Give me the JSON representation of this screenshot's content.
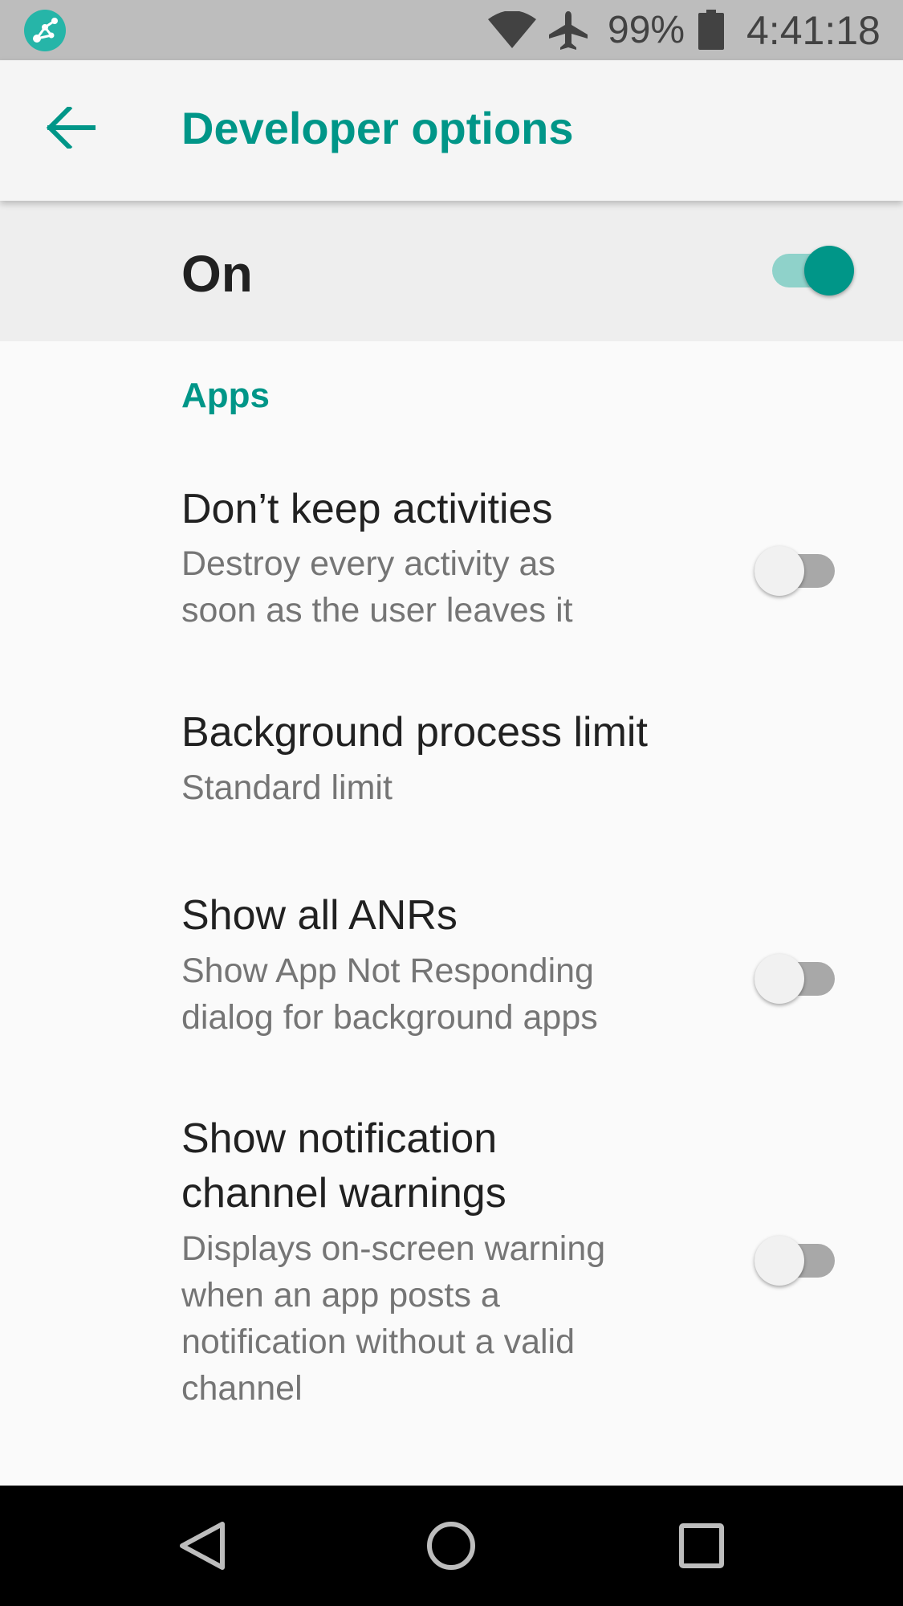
{
  "status_bar": {
    "app_badge_icon": "app-badge-icon",
    "wifi_icon": "wifi-icon",
    "airplane_icon": "airplane-icon",
    "battery_percent": "99%",
    "battery_icon": "battery-icon",
    "time": "4:41:18",
    "background_color": "#bdbdbd"
  },
  "app_bar": {
    "back_icon": "arrow-back-icon",
    "title": "Developer options",
    "accent_color": "#009688"
  },
  "master_switch": {
    "label": "On",
    "checked": true
  },
  "section": {
    "title": "Apps"
  },
  "settings": [
    {
      "title": "Don’t keep activities",
      "summary_lines": [
        "Destroy every activity as",
        "soon as the user leaves it"
      ],
      "has_toggle": true,
      "checked": false
    },
    {
      "title": "Background process limit",
      "summary_lines": [
        "Standard limit"
      ],
      "has_toggle": false
    },
    {
      "title": "Show all ANRs",
      "summary_lines": [
        "Show App Not Responding",
        "dialog for background apps"
      ],
      "has_toggle": true,
      "checked": false
    },
    {
      "title_lines": [
        "Show notification",
        "channel warnings"
      ],
      "summary_lines": [
        "Displays on-screen warning",
        "when an app posts a",
        "notification without a valid",
        "channel"
      ],
      "has_toggle": true,
      "checked": false
    }
  ],
  "nav_bar": {
    "back_icon": "nav-back-triangle-icon",
    "home_icon": "nav-home-circle-icon",
    "recents_icon": "nav-recents-square-icon"
  }
}
